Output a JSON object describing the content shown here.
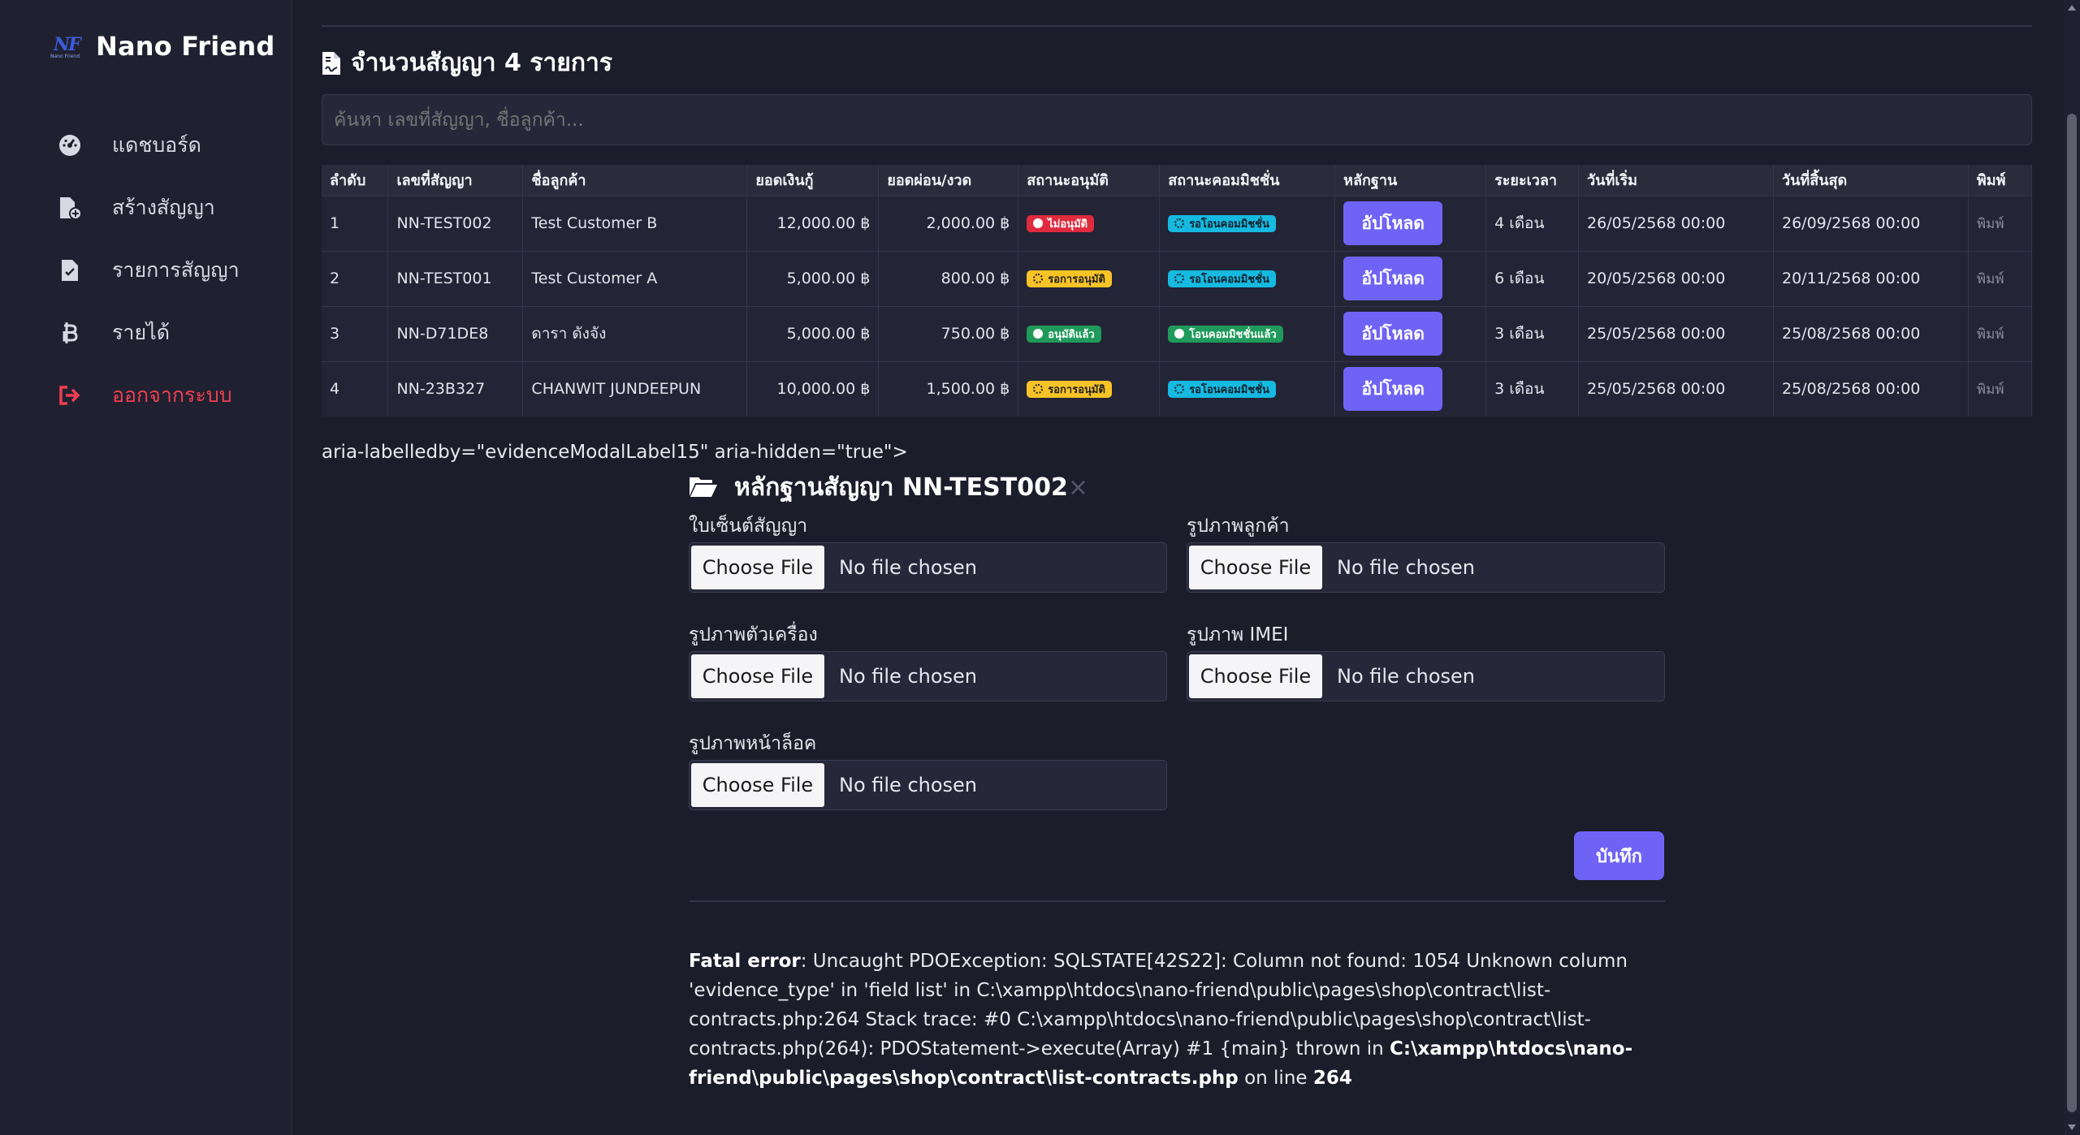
{
  "sidebar": {
    "brand_name": "Nano Friend",
    "logo_text": "NF",
    "logo_subtext": "Nano Friend",
    "items": [
      {
        "label": "แดชบอร์ด",
        "icon": "dashboard-gauge-icon"
      },
      {
        "label": "สร้างสัญญา",
        "icon": "file-add-icon"
      },
      {
        "label": "รายการสัญญา",
        "icon": "file-list-icon"
      },
      {
        "label": "รายได้",
        "icon": "baht-icon"
      },
      {
        "label": "ออกจากระบบ",
        "icon": "logout-icon",
        "color": "#ef3e53"
      }
    ]
  },
  "main": {
    "heading": "จำนวนสัญญา 4 รายการ",
    "search_placeholder": "ค้นหา เลขที่สัญญา, ชื่อลูกค้า...",
    "table": {
      "columns": [
        "ลำดับ",
        "เลขที่สัญญา",
        "ชื่อลูกค้า",
        "ยอดเงินกู้",
        "ยอดผ่อน/งวด",
        "สถานะอนุมัติ",
        "สถานะคอมมิชชั่น",
        "หลักฐาน",
        "ระยะเวลา",
        "วันที่เริ่ม",
        "วันที่สิ้นสุด",
        "พิมพ์"
      ],
      "rows": [
        {
          "no": "1",
          "contract": "NN-TEST002",
          "customer": "Test Customer B",
          "loan": "12,000.00 ฿",
          "installment": "2,000.00 ฿",
          "approval": "ไม่อนุมัติ",
          "approval_style": "red",
          "commission": "รอโอนคอมมิชชั่น",
          "commission_style": "cyan",
          "upload": "อัปโหลด",
          "duration": "4 เดือน",
          "start": "26/05/2568 00:00",
          "end": "26/09/2568 00:00",
          "print": "พิมพ์"
        },
        {
          "no": "2",
          "contract": "NN-TEST001",
          "customer": "Test Customer A",
          "loan": "5,000.00 ฿",
          "installment": "800.00 ฿",
          "approval": "รอการอนุมัติ",
          "approval_style": "yellow",
          "commission": "รอโอนคอมมิชชั่น",
          "commission_style": "cyan",
          "upload": "อัปโหลด",
          "duration": "6 เดือน",
          "start": "20/05/2568 00:00",
          "end": "20/11/2568 00:00",
          "print": "พิมพ์"
        },
        {
          "no": "3",
          "contract": "NN-D71DE8",
          "customer": "ดารา ดังจัง",
          "loan": "5,000.00 ฿",
          "installment": "750.00 ฿",
          "approval": "อนุมัติแล้ว",
          "approval_style": "green",
          "commission": "โอนคอมมิชชั่นแล้ว",
          "commission_style": "green",
          "upload": "อัปโหลด",
          "duration": "3 เดือน",
          "start": "25/05/2568 00:00",
          "end": "25/08/2568 00:00",
          "print": "พิมพ์"
        },
        {
          "no": "4",
          "contract": "NN-23B327",
          "customer": "CHANWIT JUNDEEPUN",
          "loan": "10,000.00 ฿",
          "installment": "1,500.00 ฿",
          "approval": "รอการอนุมัติ",
          "approval_style": "yellow",
          "commission": "รอโอนคอมมิชชั่น",
          "commission_style": "cyan",
          "upload": "อัปโหลด",
          "duration": "3 เดือน",
          "start": "25/05/2568 00:00",
          "end": "25/08/2568 00:00",
          "print": "พิมพ์"
        }
      ]
    },
    "raw_text": "aria-labelledby=\"evidenceModalLabel15\" aria-hidden=\"true\">"
  },
  "modal": {
    "title": "หลักฐานสัญญา NN-TEST002",
    "close_glyph": "×",
    "fields": [
      {
        "label": "ใบเซ็นต์สัญญา",
        "button": "Choose File",
        "status": "No file chosen"
      },
      {
        "label": "รูปภาพลูกค้า",
        "button": "Choose File",
        "status": "No file chosen"
      },
      {
        "label": "รูปภาพตัวเครื่อง",
        "button": "Choose File",
        "status": "No file chosen"
      },
      {
        "label": "รูปภาพ IMEI",
        "button": "Choose File",
        "status": "No file chosen"
      },
      {
        "label": "รูปภาพหน้าล็อค",
        "button": "Choose File",
        "status": "No file chosen"
      }
    ],
    "save_label": "บันทึก"
  },
  "error": {
    "prefix": "Fatal error",
    "message": ": Uncaught PDOException: SQLSTATE[42S22]: Column not found: 1054 Unknown column 'evidence_type' in 'field list' in C:\\xampp\\htdocs\\nano-friend\\public\\pages\\shop\\contract\\list-contracts.php:264 Stack trace: #0 C:\\xampp\\htdocs\\nano-friend\\public\\pages\\shop\\contract\\list-contracts.php(264): PDOStatement->execute(Array) #1 {main} thrown in ",
    "file": "C:\\xampp\\htdocs\\nano-friend\\public\\pages\\shop\\contract\\list-contracts.php",
    "on_line": " on line ",
    "line": "264"
  },
  "colors": {
    "background": "#1c1d2b",
    "sidebar": "#202130",
    "accent": "#6f63f6",
    "danger": "#ef3e53",
    "warning": "#f8c326",
    "info": "#16b9e0",
    "success": "#1f9a5a"
  }
}
